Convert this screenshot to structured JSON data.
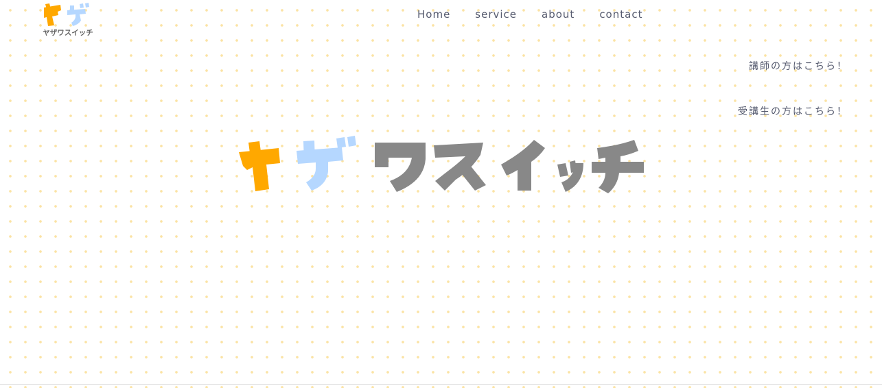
{
  "brand": {
    "logo_text": "ヤザワスイッチ",
    "colors": {
      "orange": "#ffa800",
      "blue": "#b5d7ff",
      "gray": "#888888"
    }
  },
  "nav": {
    "items": [
      {
        "label": "Home"
      },
      {
        "label": "service"
      },
      {
        "label": "about"
      },
      {
        "label": "contact"
      }
    ]
  },
  "side_links": {
    "instructor": "講師の方はこちら！",
    "student": "受講生の方はこちら！"
  },
  "theme": {
    "text_color": "#555a6e",
    "dot_color": "#fbe3a4"
  }
}
